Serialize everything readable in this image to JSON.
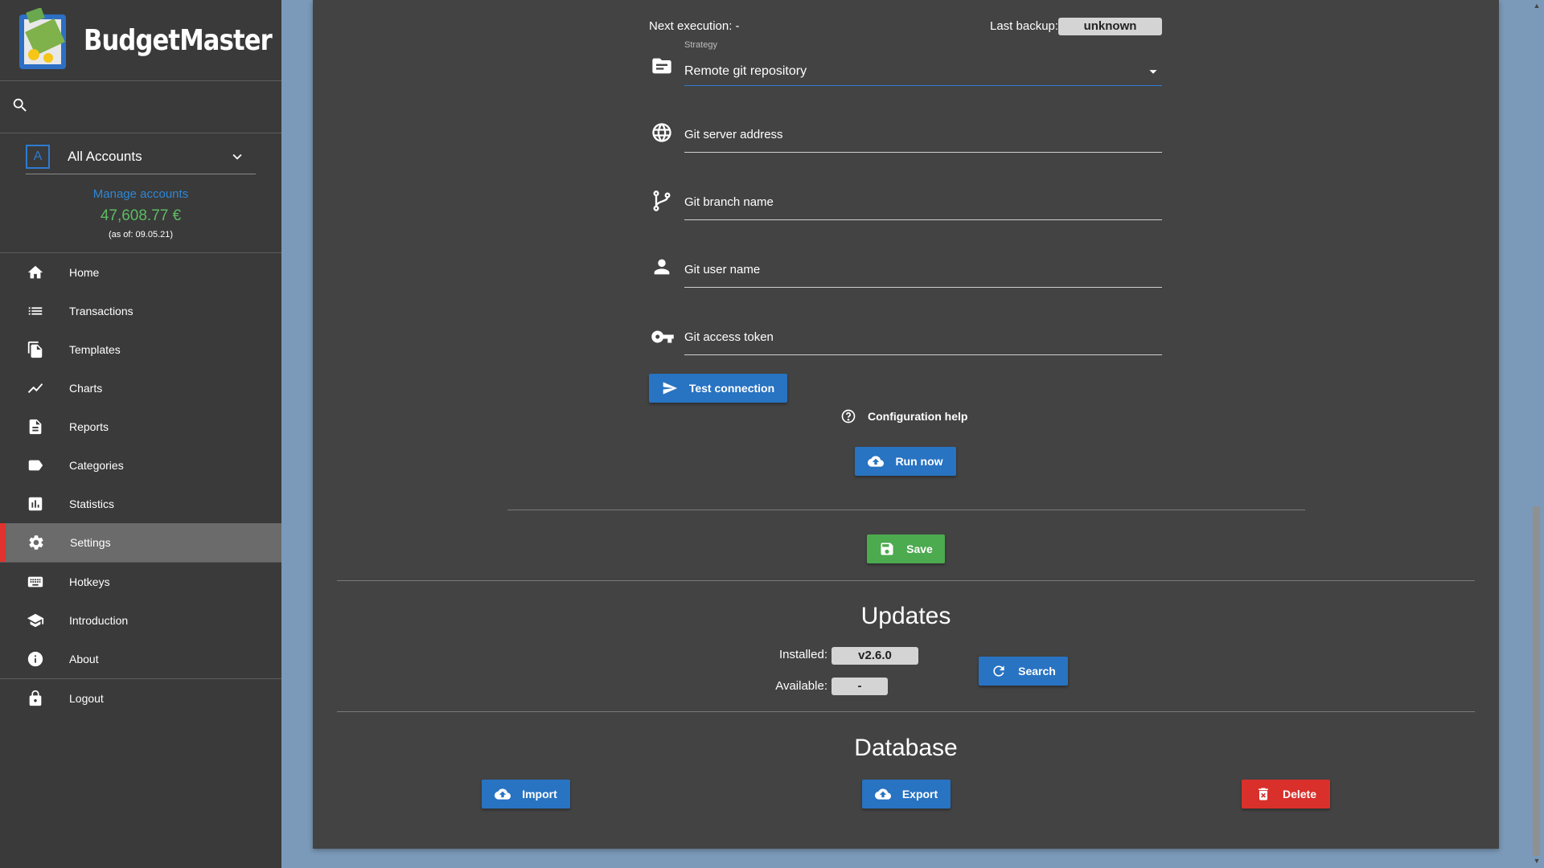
{
  "app": {
    "name": "BudgetMaster"
  },
  "sidebar": {
    "account_selector": {
      "icon_letter": "A",
      "label": "All Accounts"
    },
    "manage_accounts": "Manage accounts",
    "balance": "47,608.77 €",
    "as_of": "(as of: 09.05.21)",
    "nav": [
      {
        "label": "Home",
        "icon": "home-icon"
      },
      {
        "label": "Transactions",
        "icon": "list-icon"
      },
      {
        "label": "Templates",
        "icon": "file-copy-icon"
      },
      {
        "label": "Charts",
        "icon": "trend-icon"
      },
      {
        "label": "Reports",
        "icon": "document-icon"
      },
      {
        "label": "Categories",
        "icon": "label-icon"
      },
      {
        "label": "Statistics",
        "icon": "bar-chart-icon"
      },
      {
        "label": "Settings",
        "icon": "gear-icon",
        "active": true
      },
      {
        "label": "Hotkeys",
        "icon": "keyboard-icon"
      },
      {
        "label": "Introduction",
        "icon": "graduation-cap-icon"
      },
      {
        "label": "About",
        "icon": "info-icon"
      },
      {
        "label": "Logout",
        "icon": "lock-icon"
      }
    ]
  },
  "backup": {
    "next_execution_label": "Next execution: -",
    "last_backup_label": "Last backup:",
    "last_backup_value": "unknown",
    "strategy_label": "Strategy",
    "strategy_value": "Remote git repository",
    "fields": [
      {
        "label": "Git server address",
        "icon": "globe-icon"
      },
      {
        "label": "Git branch name",
        "icon": "branch-icon"
      },
      {
        "label": "Git user name",
        "icon": "person-icon"
      },
      {
        "label": "Git access token",
        "icon": "key-icon"
      }
    ],
    "test_connection": "Test connection",
    "configuration_help": "Configuration help",
    "run_now": "Run now"
  },
  "save": "Save",
  "updates": {
    "title": "Updates",
    "installed_label": "Installed:",
    "installed_value": "v2.6.0",
    "available_label": "Available:",
    "available_value": "-",
    "search": "Search"
  },
  "database": {
    "title": "Database",
    "import": "Import",
    "export": "Export",
    "delete": "Delete"
  },
  "colors": {
    "sidebar_bg": "#3a3a3a",
    "panel_bg": "#434343",
    "page_bg": "#7b9ab9",
    "primary_blue": "#2873c2",
    "save_green": "#4caa4f",
    "delete_red": "#d9302b",
    "balance_green": "#5dbb63",
    "active_marker": "#e0322e"
  }
}
